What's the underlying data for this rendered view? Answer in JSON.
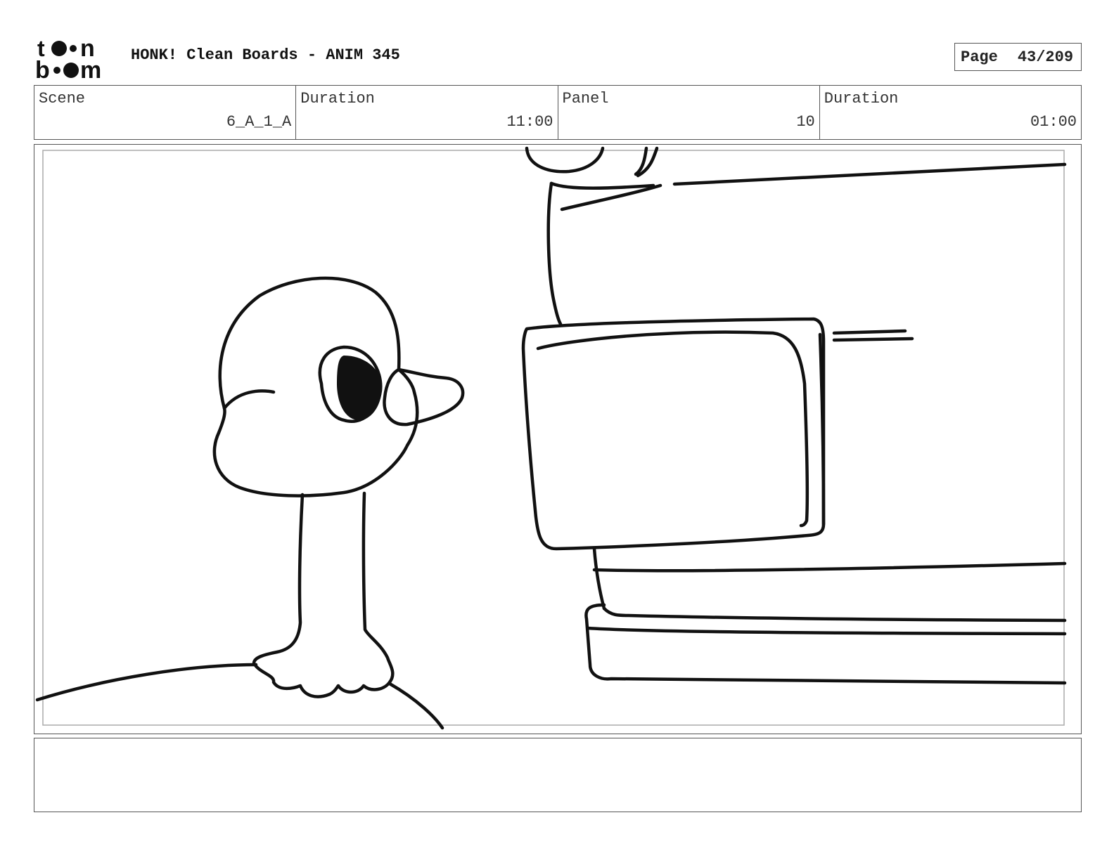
{
  "header": {
    "logo_text": "toon boom",
    "title": "HONK! Clean Boards - ANIM 345",
    "page_label": "Page",
    "page_number": "43/209"
  },
  "info": {
    "scene_label": "Scene",
    "scene_value": "6_A_1_A",
    "scene_duration_label": "Duration",
    "scene_duration_value": "11:00",
    "panel_label": "Panel",
    "panel_value": "10",
    "panel_duration_label": "Duration",
    "panel_duration_value": "01:00"
  },
  "panel": {
    "drawing_subjects": [
      "goose-head",
      "goose-body",
      "coffee-machine"
    ]
  },
  "notes": {
    "text": ""
  }
}
